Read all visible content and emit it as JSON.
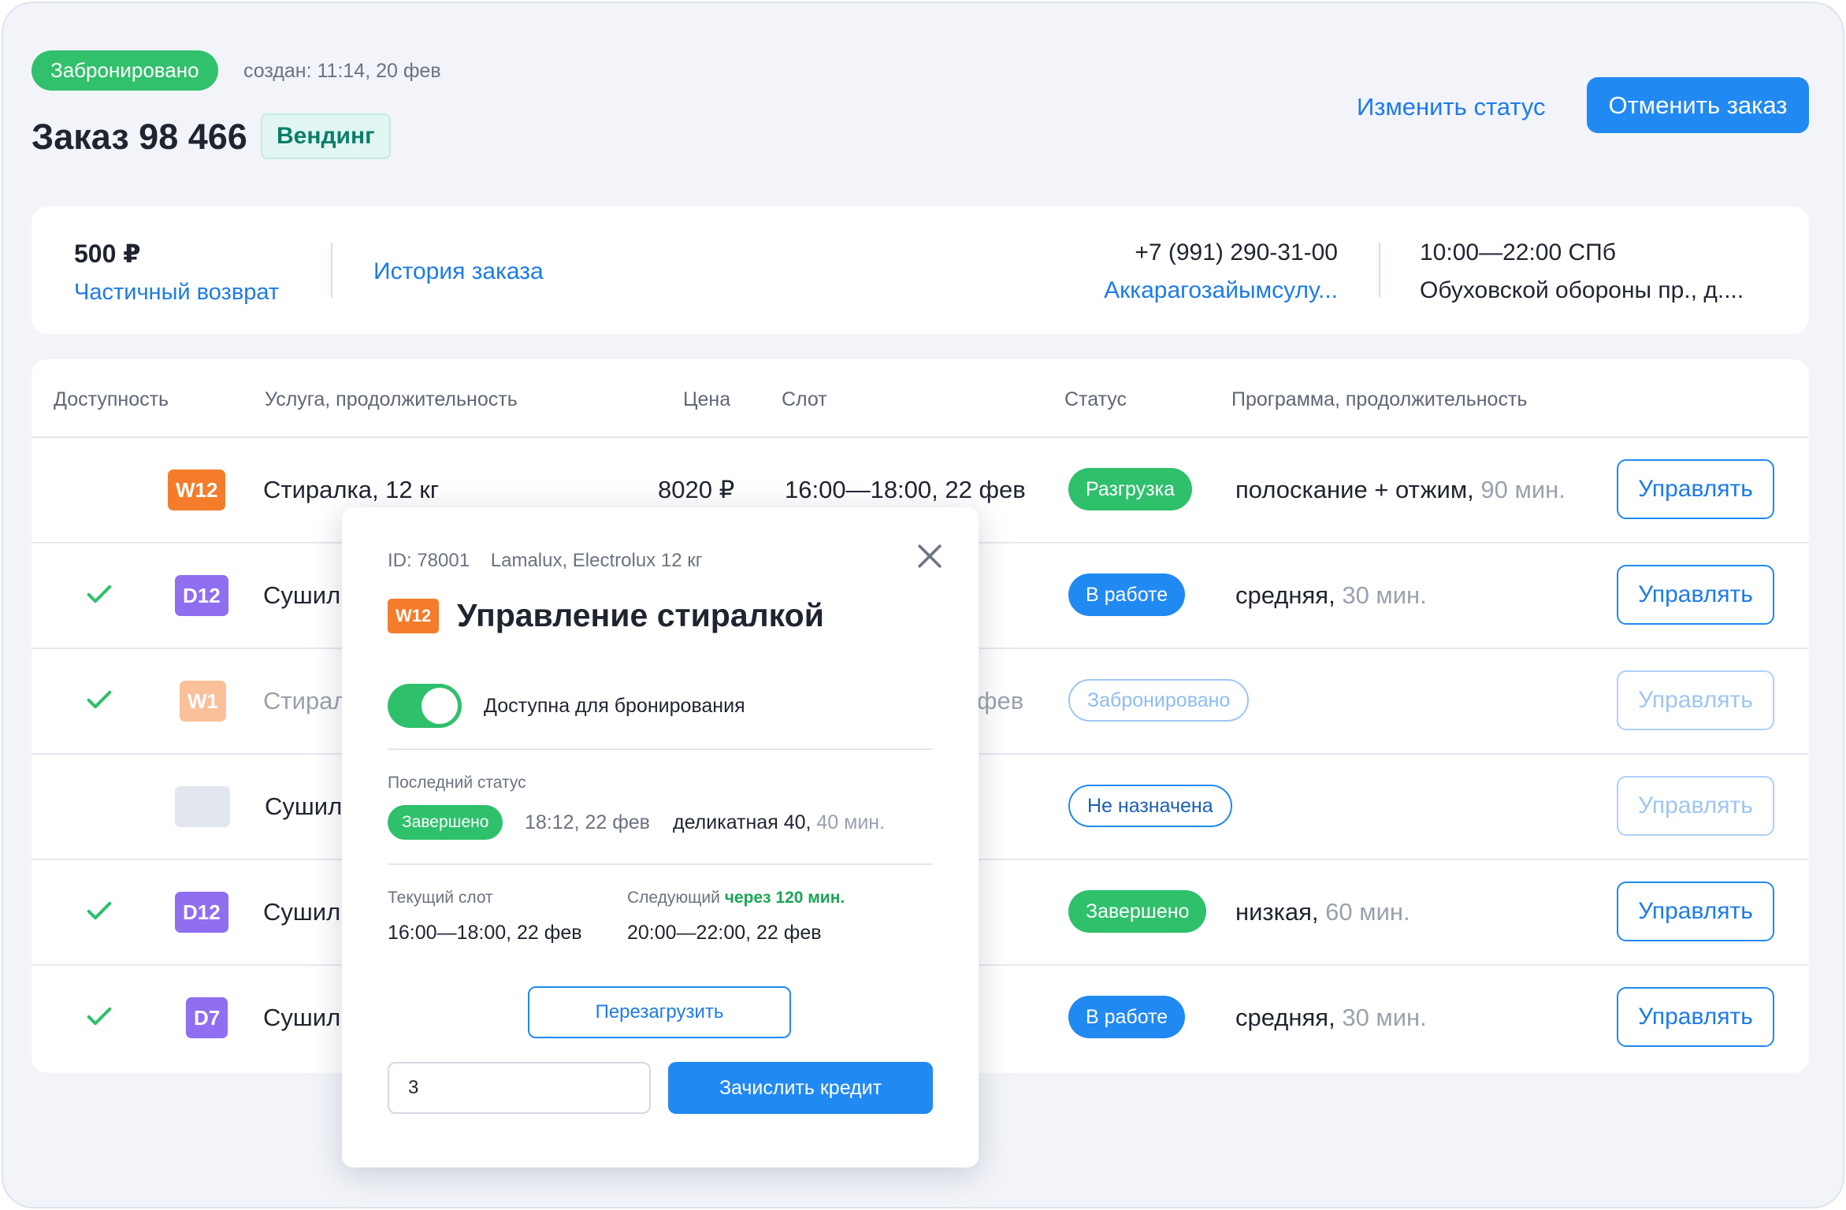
{
  "header": {
    "status_badge": "Забронировано",
    "created": "создан: 11:14, 20 фев",
    "order_title": "Заказ 98 466",
    "type_badge": "Вендинг",
    "change_status": "Изменить статус",
    "cancel_order": "Отменить заказ"
  },
  "info": {
    "amount": "500 ₽",
    "refund": "Частичный возврат",
    "history": "История заказа",
    "phone": "+7 (991) 290-31-00",
    "client": "Аккарагозайымсулу...",
    "hours": "10:00—22:00  СПб",
    "address": "Обуховской обороны пр., д...."
  },
  "table": {
    "columns": {
      "availability": "Доступность",
      "service": "Услуга, продолжительность",
      "price": "Цена",
      "slot": "Слот",
      "status": "Статус",
      "program": "Программа, продолжительность"
    },
    "manage_label": "Управлять",
    "rows": [
      {
        "check": false,
        "device": "W12",
        "service": "Стиралка, 12 кг",
        "price": "8020 ₽",
        "slot": "16:00—18:00, 22 фев",
        "status": "Разгрузка",
        "program": "полоскание + отжим,",
        "duration": "90 мин."
      },
      {
        "check": true,
        "device": "D12",
        "service": "Сушил",
        "price": "",
        "slot": "",
        "status": "В работе",
        "program": "средняя,",
        "duration": "30 мин."
      },
      {
        "check": true,
        "device": "W1",
        "service": "Стирал",
        "price": "",
        "slot": "фев",
        "status": "Забронировано",
        "program": "",
        "duration": ""
      },
      {
        "check": false,
        "device": "",
        "service": "Сушил",
        "price": "",
        "slot": "",
        "status": "Не назначена",
        "program": "",
        "duration": ""
      },
      {
        "check": true,
        "device": "D12",
        "service": "Сушил",
        "price": "",
        "slot": "",
        "status": "Завершено",
        "program": "низкая,",
        "duration": "60 мин."
      },
      {
        "check": true,
        "device": "D7",
        "service": "Сушил",
        "price": "",
        "slot": "",
        "status": "В работе",
        "program": "средняя,",
        "duration": "30 мин."
      }
    ]
  },
  "popup": {
    "id": "ID: 78001",
    "model": "Lamalux, Electrolux 12 кг",
    "badge": "W12",
    "title": "Управление стиралкой",
    "toggle_label": "Доступна для бронирования",
    "last_status_label": "Последний статус",
    "last_status": "Завершено",
    "last_status_time": "18:12, 22 фев",
    "last_program": "деликатная 40,",
    "last_duration": "40 мин.",
    "current_slot_label": "Текущий слот",
    "current_slot": "16:00—18:00, 22 фев",
    "next_label": "Следующий",
    "next_in": "через 120 мин.",
    "next_slot": "20:00—22:00, 22 фев",
    "reload": "Перезагрузить",
    "credit_value": "3",
    "credit_button": "Зачислить кредит"
  },
  "colors": {
    "accent": "#2189f2",
    "success": "#2ec06b",
    "washer": "#f47c2a",
    "dryer": "#8f6ef0"
  }
}
